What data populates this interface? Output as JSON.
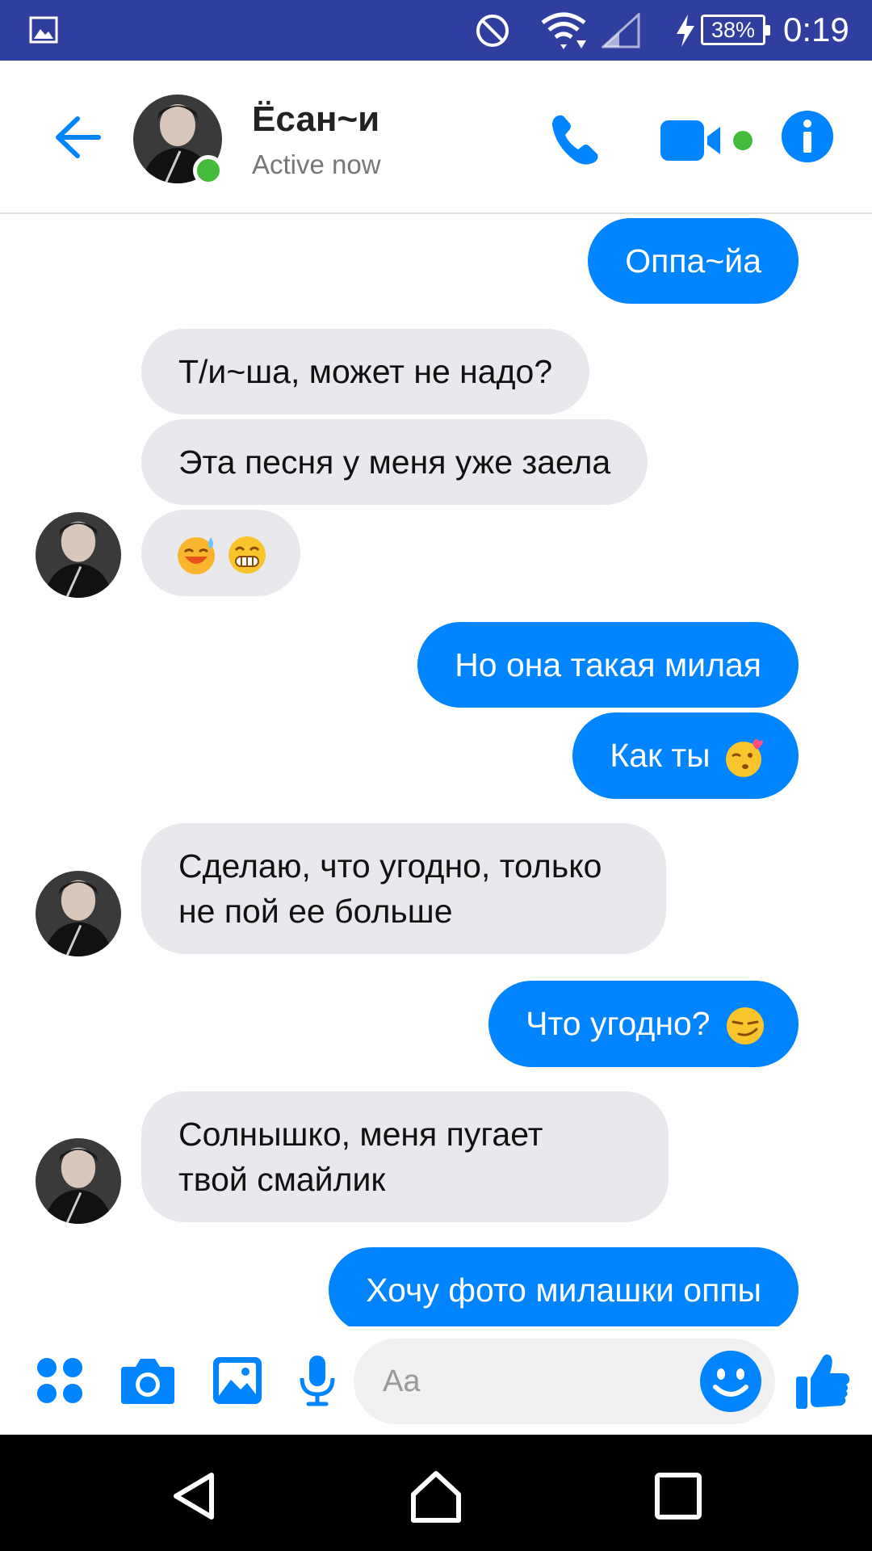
{
  "status_bar": {
    "battery": "38%",
    "time": "0:19"
  },
  "header": {
    "contact_name": "Ёсан~и",
    "contact_status": "Active now"
  },
  "messages": [
    {
      "side": "out",
      "text": "Оппа~йа"
    },
    {
      "side": "in",
      "text": "Т/и~ша, может не надо?"
    },
    {
      "side": "in",
      "text": "Эта песня у меня уже заела"
    },
    {
      "side": "in",
      "emoji": [
        "sweat-smile-emoji",
        "grin-emoji"
      ]
    },
    {
      "side": "out",
      "text": "Но она такая милая"
    },
    {
      "side": "out",
      "text": "Как ты",
      "emoji": [
        "kissing-heart-emoji"
      ]
    },
    {
      "side": "in",
      "lines": [
        "Сделаю, что угодно, только",
        "не пой ее больше"
      ]
    },
    {
      "side": "out",
      "text": "Что угодно?",
      "emoji": [
        "smirk-emoji"
      ]
    },
    {
      "side": "in",
      "lines": [
        "Солнышко, меня пугает",
        "твой смайлик"
      ]
    },
    {
      "side": "out",
      "text": "Хочу фото милашки оппы"
    }
  ],
  "composer": {
    "placeholder": "Aa"
  },
  "colors": {
    "accent": "#0084ff",
    "status_bar": "#303f9f",
    "incoming_bubble": "#e9e8ed",
    "online": "#44bb3b"
  },
  "icons": [
    "gallery-icon",
    "dnd-icon",
    "wifi-icon",
    "signal-icon",
    "charging-icon",
    "back-arrow-icon",
    "phone-icon",
    "video-camera-icon",
    "info-icon",
    "more-apps-icon",
    "camera-icon",
    "image-icon",
    "microphone-icon",
    "smiley-icon",
    "thumbs-up-icon",
    "nav-back-icon",
    "nav-home-icon",
    "nav-recents-icon"
  ]
}
